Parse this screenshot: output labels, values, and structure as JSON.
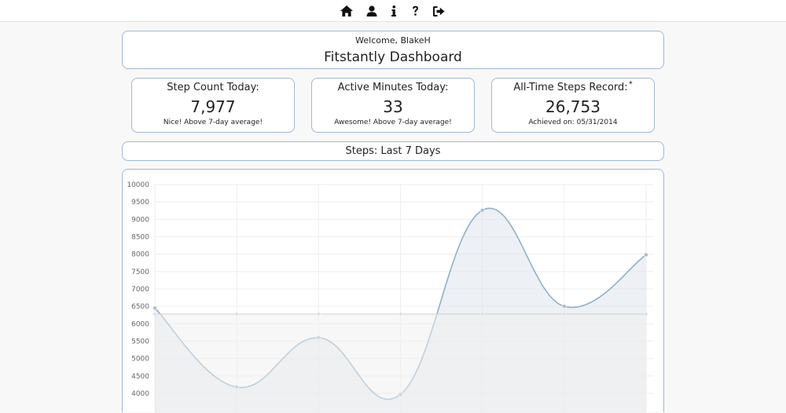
{
  "nav": {
    "items": [
      {
        "name": "home-icon",
        "icon": "home"
      },
      {
        "name": "user-icon",
        "icon": "user"
      },
      {
        "name": "info-icon",
        "icon": "info"
      },
      {
        "name": "help-icon",
        "icon": "question"
      },
      {
        "name": "sign-out-icon",
        "icon": "sign-out"
      }
    ]
  },
  "header": {
    "welcome": "Welcome, BlakeH",
    "title": "Fitstantly Dashboard"
  },
  "cards": [
    {
      "label": "Step Count Today:",
      "value": "7,977",
      "note": "Nice! Above 7-day average!"
    },
    {
      "label": "Active Minutes Today:",
      "value": "33",
      "note": "Awesome! Above 7-day average!"
    },
    {
      "label": "All-Time Steps Record:",
      "marker": "*",
      "value": "26,753",
      "note": "Achieved on: 05/31/2014"
    }
  ],
  "chart_title": "Steps: Last 7 Days",
  "colors": {
    "accent_border": "#9fb8d3",
    "series_line": "#8fb0c8",
    "series_fill": "#dfe6ec",
    "average_line": "#d3d3d3"
  },
  "chart_data": {
    "type": "line",
    "title": "Steps: Last 7 Days",
    "xlabel": "",
    "ylabel": "",
    "ylim": [
      4000,
      10000
    ],
    "y_ticks": [
      10000,
      9500,
      9000,
      8500,
      8000,
      7500,
      7000,
      6500,
      6000,
      5500,
      5000,
      4500,
      4000
    ],
    "grid": true,
    "smooth": true,
    "series": [
      {
        "values": [
          6450,
          4180,
          5600,
          3970,
          9260,
          6500,
          7980
        ],
        "fill": true
      },
      {
        "values": [
          6280,
          6280,
          6280,
          6280,
          6280,
          6280,
          6280
        ],
        "fill": false
      }
    ]
  }
}
